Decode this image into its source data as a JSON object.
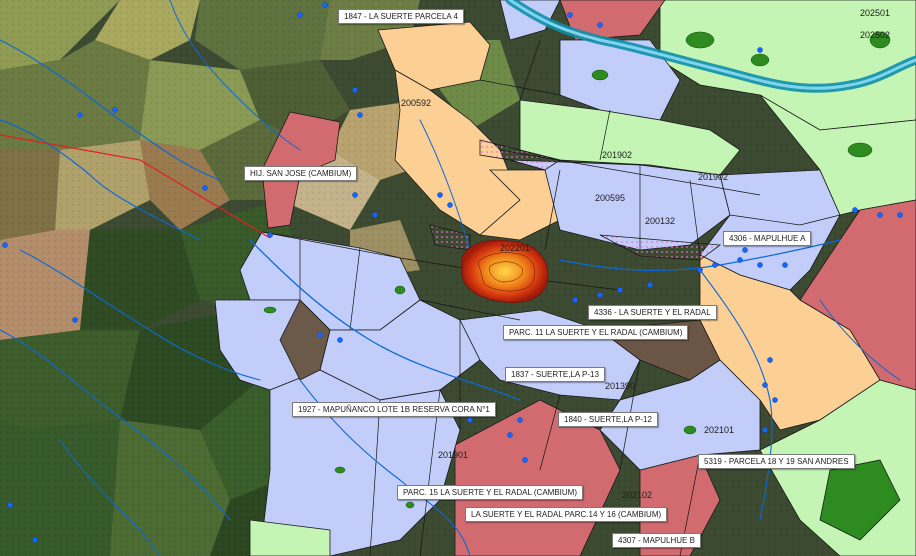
{
  "colors": {
    "parcel_blue": "#c2cdfa",
    "parcel_orange": "#fccf95",
    "parcel_red": "#d26b6f",
    "parcel_green_light": "#c4f5b4",
    "parcel_green_dark": "#2e8b1f",
    "parcel_outline": "#1a1a1a",
    "river": "#0a69d6",
    "wide_river": "#0f8fa8",
    "point_marker": "#1566ff",
    "fire_core": "#d8350e",
    "boundary_line": "#e02020"
  },
  "labels": {
    "l1847": "1847 - LA SUERTE PARCELA 4",
    "hij_san_jose": "HIJ. SAN JOSE (CAMBIUM)",
    "l4306": "4306 - MAPULHUE A",
    "l4336": "4336 - LA SUERTE Y EL RADAL",
    "parc11": "PARC. 11 LA SUERTE Y EL RADAL (CAMBIUM)",
    "l1837": "1837 - SUERTE,LA P-13",
    "l1927": "1927 - MAPUÑANCO LOTE 1B RESERVA CORA N°1",
    "l1840": "1840 - SUERTE,LA P-12",
    "l5319": "5319 - PARCELA 18 Y 19 SAN ANDRES",
    "parc15": "PARC. 15 LA SUERTE Y EL RADAL (CAMBIUM)",
    "parc14_16": "LA SUERTE Y EL RADAL PARC.14 Y 16 (CAMBIUM)",
    "l4307": "4307 - MAPULHUE B"
  },
  "polygon_ids": {
    "n200592": "200592",
    "n201902": "201902",
    "n201901": "201901",
    "n202101": "202101",
    "n201390": "201390",
    "n200595": "200595",
    "n202102": "202102",
    "n201902b": "201902",
    "n202501": "202501",
    "n202502": "202502",
    "n200132": "200132",
    "n202201": "202201"
  }
}
